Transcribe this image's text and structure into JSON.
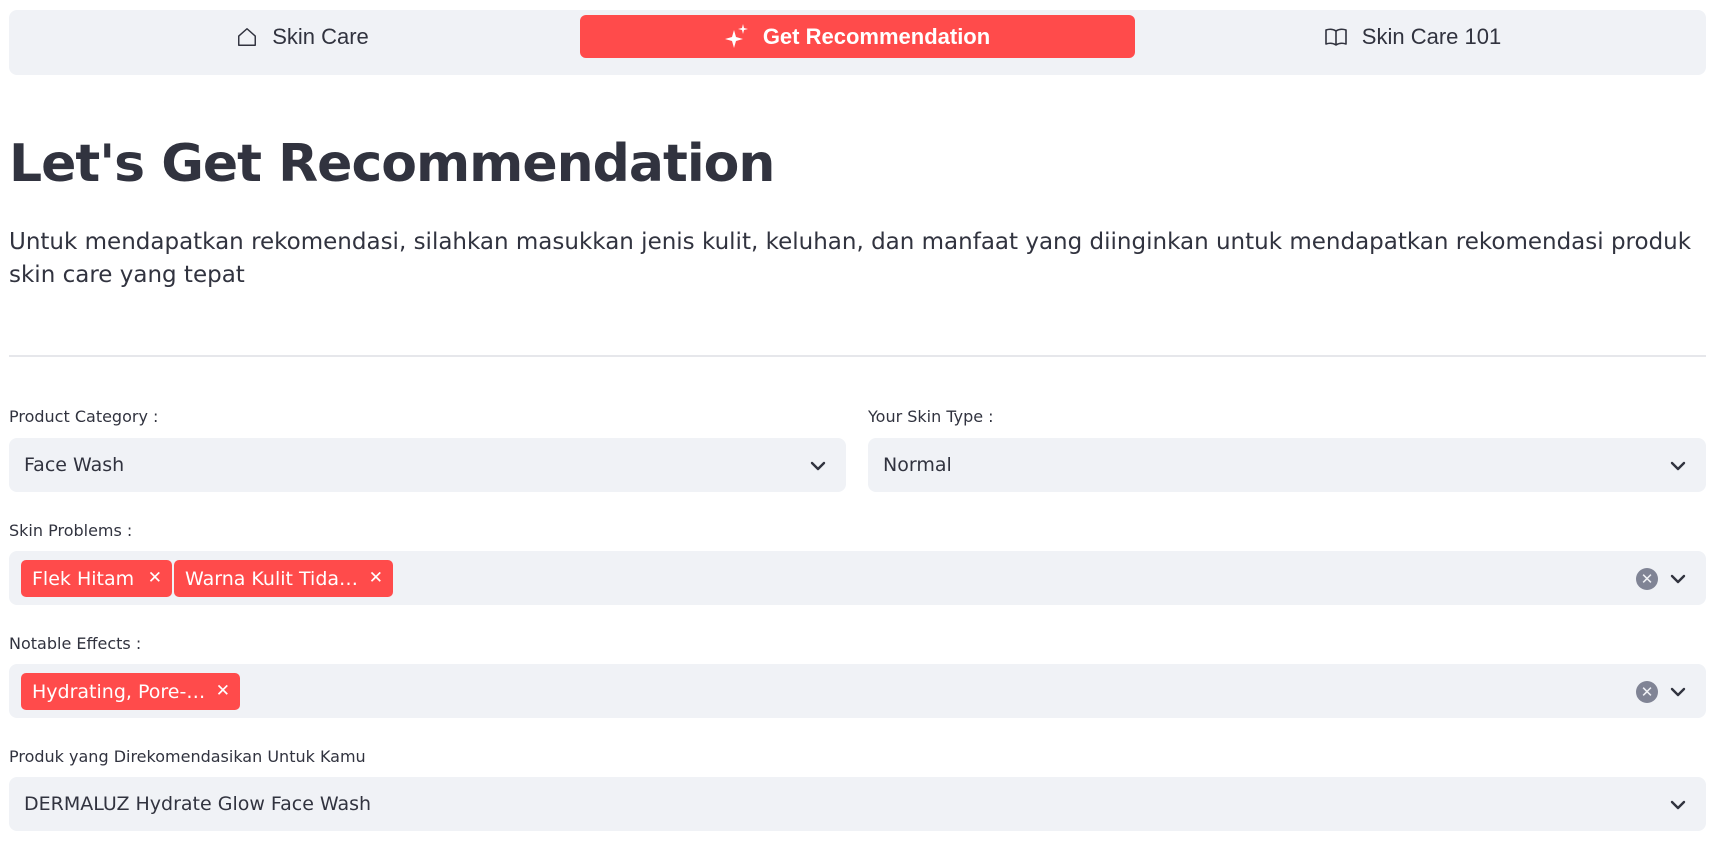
{
  "nav": {
    "items": [
      {
        "label": "Skin Care",
        "icon": "home-icon"
      },
      {
        "label": "Get Recommendation",
        "icon": "sparkles-icon",
        "active": true
      },
      {
        "label": "Skin Care 101",
        "icon": "book-icon"
      }
    ],
    "active_color": "#ff4b4b"
  },
  "page": {
    "title": "Let's Get Recommendation",
    "subtitle": "Untuk mendapatkan rekomendasi, silahkan masukkan jenis kulit, keluhan, dan manfaat yang diinginkan untuk mendapatkan rekomendasi produk skin care yang tepat"
  },
  "form": {
    "category": {
      "label": "Product Category :",
      "value": "Face Wash"
    },
    "skin_type": {
      "label": "Your Skin Type :",
      "value": "Normal"
    },
    "skin_problems": {
      "label": "Skin Problems :",
      "tags": [
        "Flek Hitam",
        "Warna Kulit Tida…"
      ]
    },
    "notable_effects": {
      "label": "Notable Effects :",
      "tags": [
        "Hydrating, Pore-…"
      ]
    },
    "recommended": {
      "label": "Produk yang Direkomendasikan Untuk Kamu",
      "value": "DERMALUZ Hydrate Glow Face Wash"
    }
  },
  "colors": {
    "accent": "#ff4b4b",
    "input_bg": "#f0f2f6",
    "text": "#31333f"
  }
}
